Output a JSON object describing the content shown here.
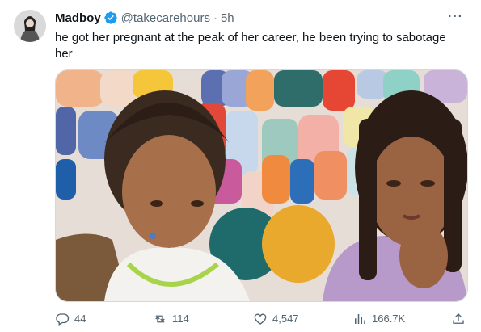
{
  "tweet": {
    "author_name": "Madboy",
    "handle": "@takecarehours",
    "separator": "·",
    "time": "5h",
    "more_label": "···",
    "text": "he got her pregnant at the peak of her career, he been trying to sabotage her"
  },
  "actions": {
    "replies": "44",
    "retweets": "114",
    "likes": "4,547",
    "views": "166.7K"
  },
  "colors": {
    "verified": "#1d9bf0",
    "muted_text": "#536471",
    "text": "#0f1419",
    "border": "#cfd9de"
  },
  "icons": [
    "verified-badge-icon",
    "more-icon",
    "reply-icon",
    "retweet-icon",
    "like-icon",
    "views-icon",
    "share-icon"
  ]
}
